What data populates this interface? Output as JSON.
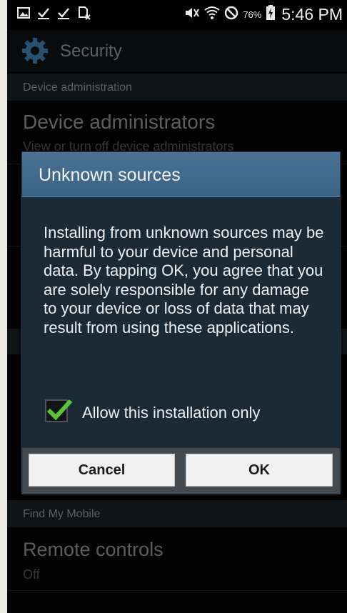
{
  "status_bar": {
    "battery_percent": "76%",
    "time": "5:46 PM",
    "left_icons": [
      "image-icon",
      "download-done-icon",
      "download-done-icon",
      "nfc-card-icon"
    ],
    "right_icons": [
      "mute-icon",
      "wifi-icon",
      "blocked-icon",
      "battery-charging-icon"
    ]
  },
  "action_bar": {
    "title": "Security",
    "icon": "gear-icon"
  },
  "settings": {
    "header_device_admin": "Device administration",
    "device_admins_title": "Device administrators",
    "device_admins_sub": "View or turn off device administrators",
    "header_find_my_mobile": "Find My Mobile",
    "remote_controls_title": "Remote controls",
    "remote_controls_sub": "Off"
  },
  "dialog": {
    "title": "Unknown sources",
    "message": "Installing from unknown sources may be harmful to your device and personal data. By tapping OK, you agree that you are solely responsible for any damage to your device or loss of data that may result from using these applications.",
    "checkbox_label": "Allow this installation only",
    "checkbox_checked": true,
    "cancel_label": "Cancel",
    "ok_label": "OK"
  },
  "colors": {
    "dialog_title_bg": "#4a7294",
    "dialog_bg": "#1c2a36",
    "check_green": "#59c43a"
  }
}
